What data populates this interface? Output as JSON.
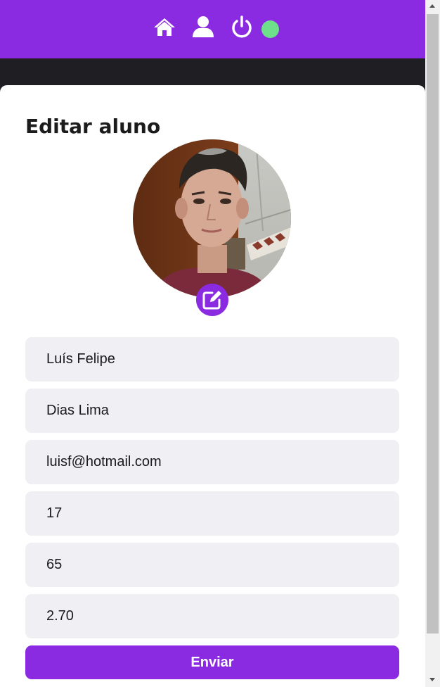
{
  "header": {
    "icons": [
      "home-icon",
      "user-icon",
      "power-icon"
    ],
    "status_color": "#6ee08b",
    "bar_color": "#8a2be2"
  },
  "page": {
    "title": "Editar aluno"
  },
  "form": {
    "nome": "Luís Felipe",
    "sobrenome": "Dias Lima",
    "email": "luisf@hotmail.com",
    "idade": "17",
    "peso": "65",
    "altura": "2.70",
    "submit_label": "Enviar"
  },
  "colors": {
    "accent": "#8a2be2",
    "field_bg": "#efeff4",
    "dark_bg": "#1f1e23"
  }
}
